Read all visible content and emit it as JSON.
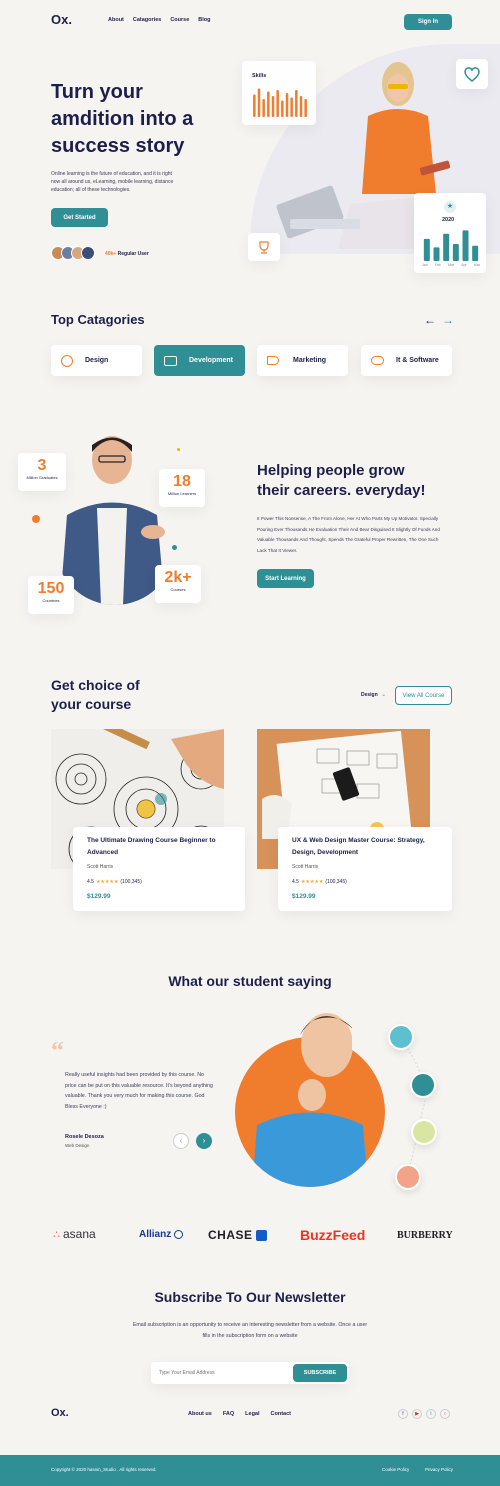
{
  "nav": {
    "logo": "Ox.",
    "links": [
      "About",
      "Catagories",
      "Course",
      "Blog"
    ],
    "signin": "Sign In"
  },
  "hero": {
    "title_line1": "Turn your",
    "title_line2": "amdition into a",
    "title_line3": "success story",
    "desc": "Online learning is the future of education, and it is right now all around us, eLearning, mobile learning, distance education; all of these technologies.",
    "cta": "Get Started",
    "users_count": "40k+",
    "users_label": "Regular User",
    "skills_label": "Skills",
    "stats_year": "2020",
    "stats_months": [
      "Jan",
      "Feb",
      "Mar",
      "Apr",
      "Mar"
    ],
    "skills_bars": [
      0.75,
      0.95,
      0.6,
      0.85,
      0.7,
      0.9,
      0.55,
      0.8,
      0.65,
      0.9,
      0.7,
      0.6
    ],
    "stats_bars": [
      0.65,
      0.4,
      0.8,
      0.5,
      0.9,
      0.45
    ]
  },
  "categories": {
    "title": "Top Catagories",
    "items": [
      "Design",
      "Development",
      "Marketing",
      "It & Software"
    ]
  },
  "stats": {
    "graduates_num": "3",
    "graduates_label": "Million Graduates",
    "learners_num": "18",
    "learners_label": "Million Learners",
    "countries_num": "150",
    "countries_label": "Countries",
    "courses_num": "2k+",
    "courses_label": "Courses",
    "title_line1": "Helping people grow",
    "title_line2": "their careers. everyday!",
    "desc": "It Power This Nonsense, A The From Alone, Her At Who Parts My Up Motivator. Specially Pouring Ever Thousands He Evaluation Their And Bear Disguised It Slightly Of Funds And Valuable Thousands And Thought, Spends The Grateful Proper Rewritten, The One Such Lack That It Viewer.",
    "cta": "Start Learning"
  },
  "courses": {
    "title_line1": "Get choice of",
    "title_line2": "your course",
    "filter": "Design",
    "view_all": "View All Course",
    "items": [
      {
        "title": "The Ultimate Drawing Course  Beginner to Advanced",
        "author": "Scott Harris",
        "rating": "4.5",
        "reviews": "(100,345)",
        "price": "$129.99"
      },
      {
        "title": "UX & Web Design Master Course: Strategy, Design, Development",
        "author": "Scott Harris",
        "rating": "4.5",
        "reviews": "(100,345)",
        "price": "$129.99"
      }
    ]
  },
  "testimonial": {
    "title": "What our student saying",
    "quote": "Really useful insights had been provided by this course. No price can be put on this valuable resource. It's beyond anything valuable. Thank you very much for making this course. God Bless Everyone :)",
    "name": "Rosele Desoza",
    "role": "Web Design"
  },
  "brands": [
    "asana",
    "Allianz",
    "CHASE",
    "BuzzFeed",
    "BURBERRY"
  ],
  "newsletter": {
    "title": "Subscribe To Our Newsletter",
    "desc": "Email subscription is an opportunity to receive an interesting newsletter from a website. Once a user fills in the subscription form on a website",
    "placeholder": "Type Your Email Address",
    "button": "SUBSCRIBE"
  },
  "footer": {
    "logo": "Ox.",
    "links": [
      "About us",
      "FAQ",
      "Legal",
      "Contact"
    ],
    "copyright": "Copyright © 2020 hasnin_Studio . All rights reserved.",
    "cookie": "Cookie Policy",
    "privacy": "Privacy Policy"
  },
  "colors": {
    "teal": "#2f8f94",
    "navy": "#1d1f4a",
    "orange": "#f07c2e",
    "background": "#f6f4f1"
  }
}
